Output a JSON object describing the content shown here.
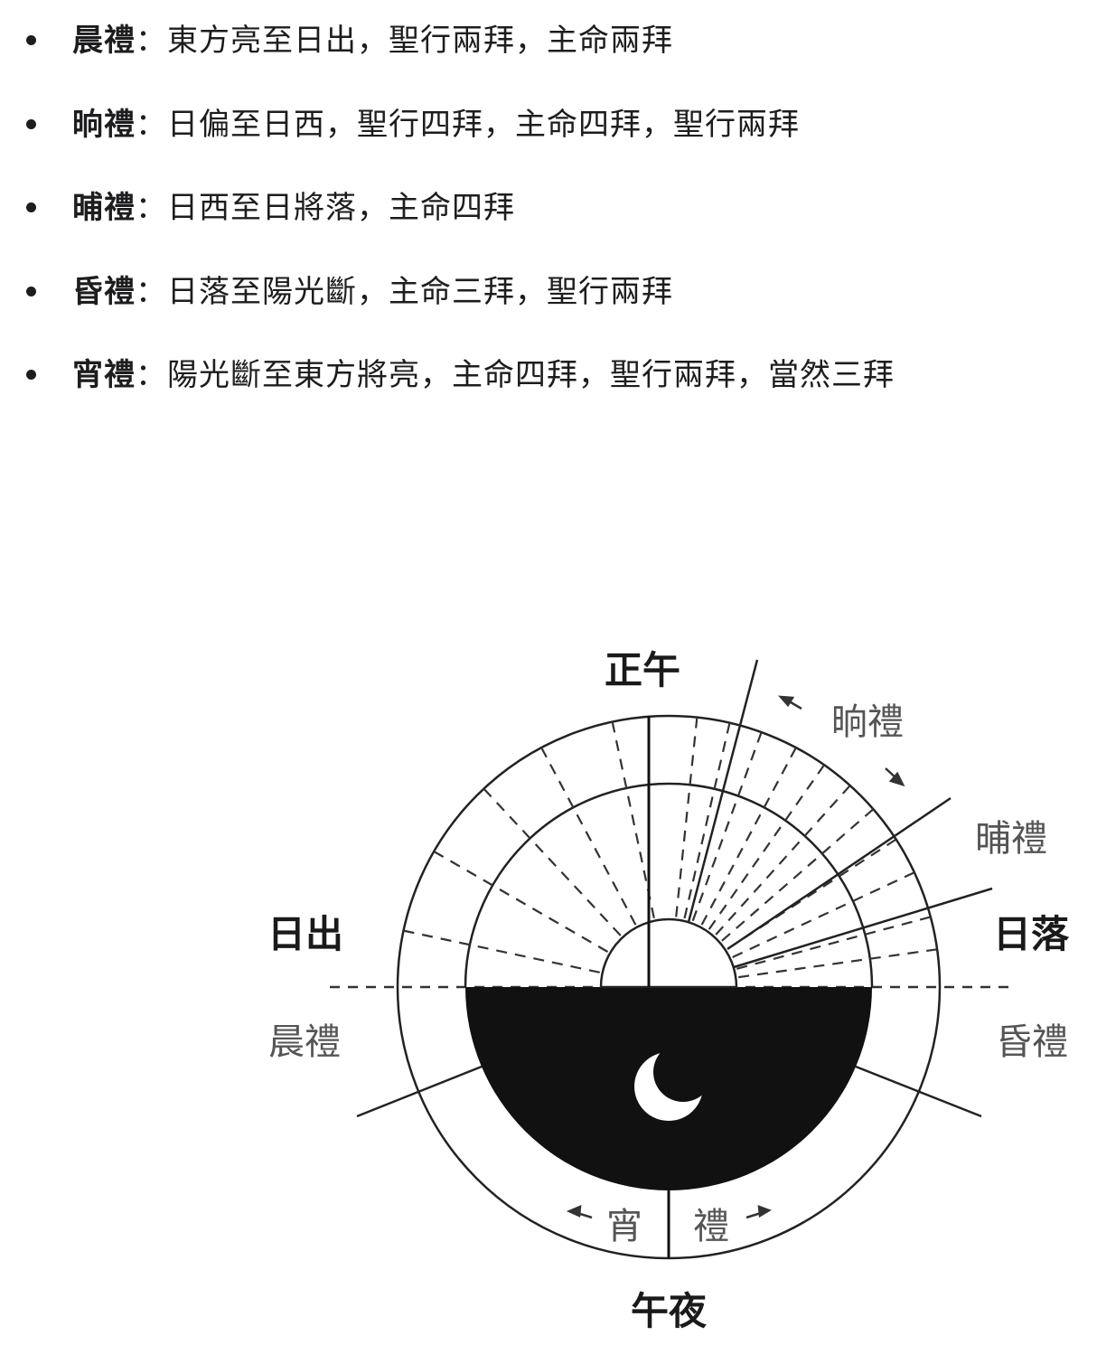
{
  "prayers": [
    {
      "name": "晨禮",
      "colon": "：",
      "desc": "東方亮至日出，聖行兩拜，主命兩拜"
    },
    {
      "name": "晌禮",
      "colon": "：",
      "desc": "日偏至日西，聖行四拜，主命四拜，聖行兩拜"
    },
    {
      "name": "晡禮",
      "colon": "：",
      "desc": "日西至日將落，主命四拜"
    },
    {
      "name": "昏禮",
      "colon": "：",
      "desc": "日落至陽光斷，主命三拜，聖行兩拜"
    },
    {
      "name": "宵禮",
      "colon": "：",
      "desc": "陽光斷至東方將亮，主命四拜，聖行兩拜，當然三拜"
    }
  ],
  "diagram": {
    "labels": {
      "noon": "正午",
      "midnight": "午夜",
      "sunrise": "日出",
      "sunset": "日落",
      "dhuhr": "晌禮",
      "asr": "晡禮",
      "fajr": "晨禮",
      "maghrib": "昏禮",
      "isha_left": "宵",
      "isha_right": "禮"
    },
    "icons": [
      "crescent-moon-icon",
      "arrow-icon"
    ]
  }
}
